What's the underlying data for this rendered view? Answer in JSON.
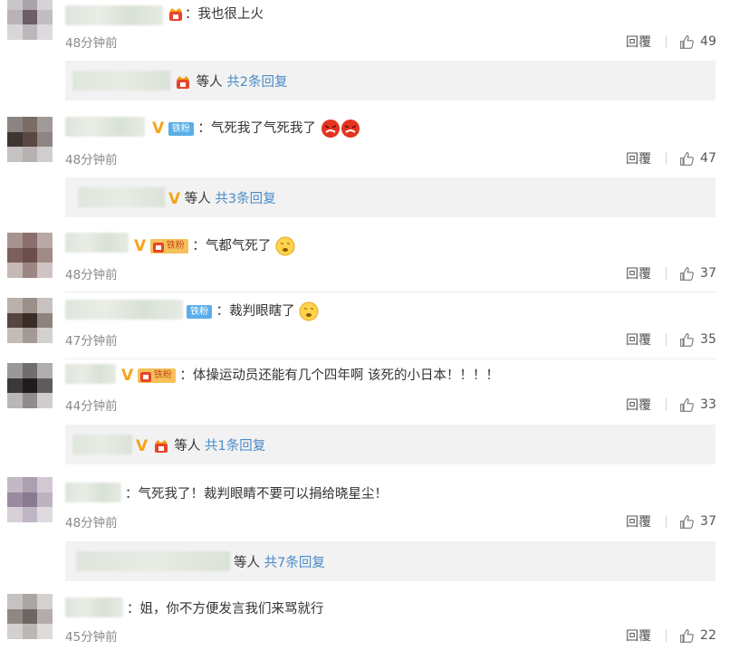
{
  "ui": {
    "reply_label": "回覆",
    "stack_suffix": "等人",
    "accent_link": "#4a8bc8",
    "v_color": "#f5a31a"
  },
  "comments": [
    {
      "text": "：我也很上火",
      "time": "48分钟前",
      "likes": "49"
    },
    {
      "text": "：气死我了气死我了",
      "time": "48分钟前",
      "likes": "47",
      "fan": "铁粉"
    },
    {
      "text": "：气都气死了",
      "time": "48分钟前",
      "likes": "37",
      "fan": "铁粉"
    },
    {
      "text": "：裁判眼瞎了",
      "time": "47分钟前",
      "likes": "35",
      "fan": "铁粉"
    },
    {
      "text": "：体操运动员还能有几个四年啊 该死的小日本！！！！",
      "time": "44分钟前",
      "likes": "33",
      "fan": "铁粉"
    },
    {
      "text": "：气死我了！裁判眼睛不要可以捐给晓星尘！",
      "time": "48分钟前",
      "likes": "37"
    },
    {
      "text": "：姐，你不方便发言我们来骂就行",
      "time": "45分钟前",
      "likes": "22"
    }
  ],
  "replies": [
    {
      "label": "等人",
      "count": "共2条回复"
    },
    {
      "label": "等人",
      "count": "共3条回复"
    },
    {
      "label": "等人",
      "count": "共1条回复"
    },
    {
      "label": "等人",
      "count": "共7条回复"
    }
  ]
}
